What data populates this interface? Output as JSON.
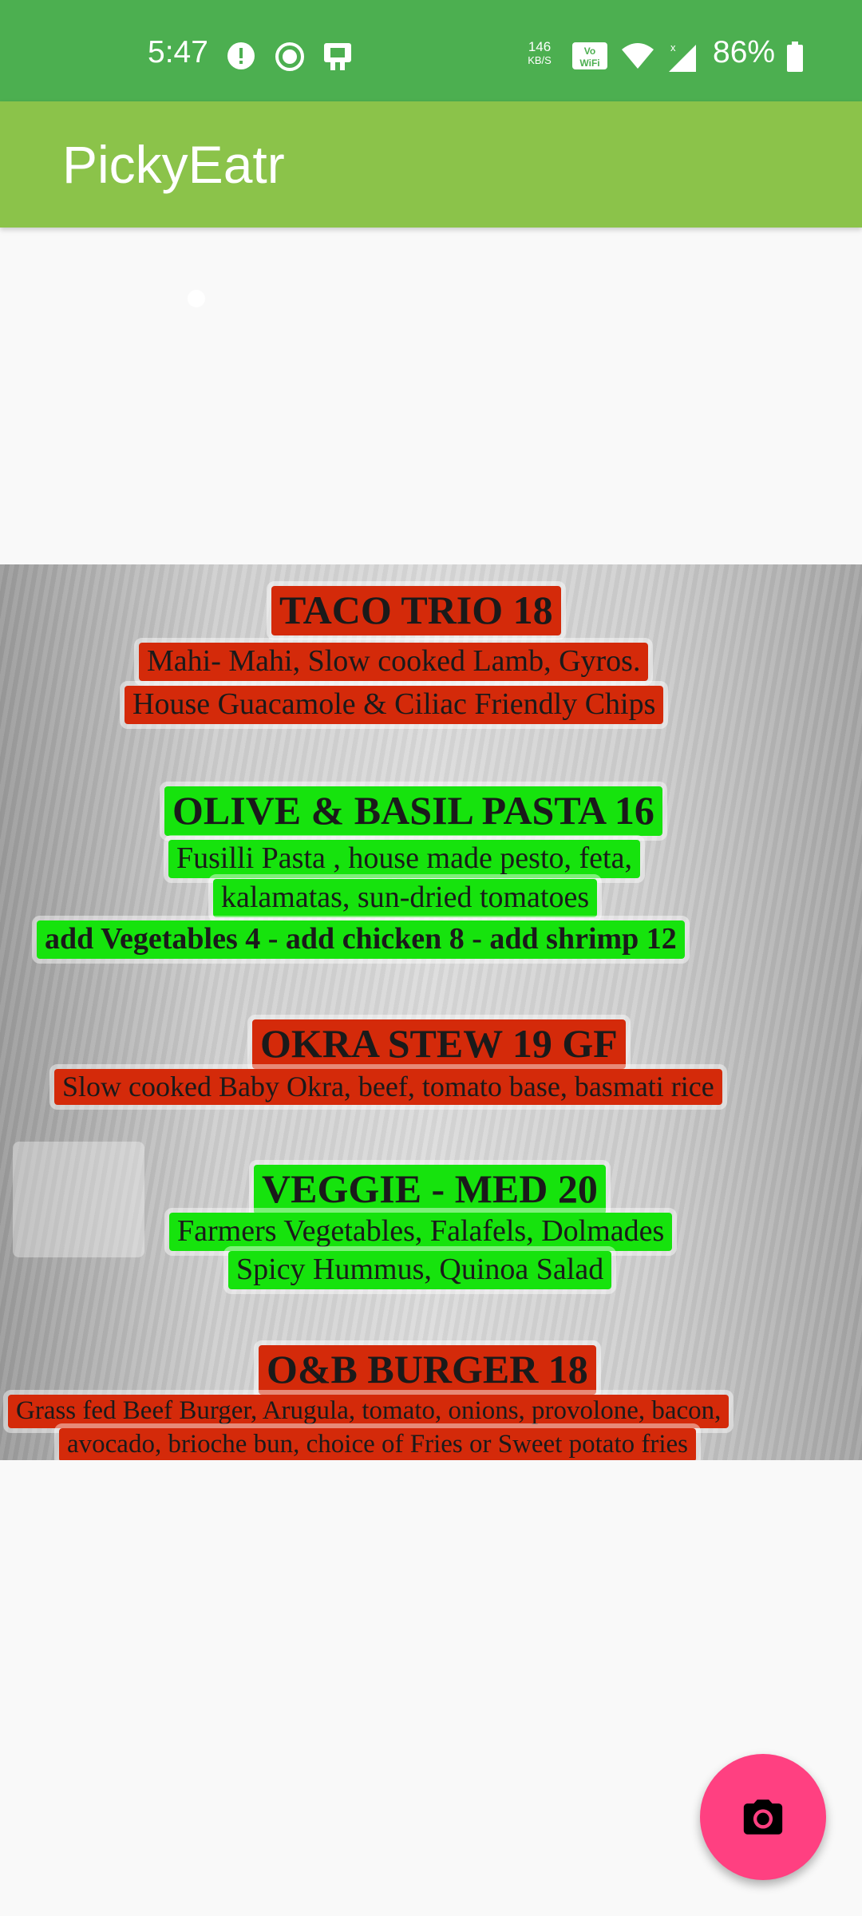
{
  "status_bar": {
    "time": "5:47",
    "net_speed": "146",
    "net_unit": "KB/S",
    "battery_pct": "86%",
    "icons": [
      "alert-icon",
      "record-icon",
      "device-icon",
      "volte-wifi-icon",
      "wifi-icon",
      "signal-icon",
      "battery-icon"
    ]
  },
  "app_bar": {
    "title": "PickyEatr",
    "color": "#8bc34a"
  },
  "menu": {
    "lines": [
      {
        "text": "TACO TRIO  18",
        "status": "red",
        "kind": "heading"
      },
      {
        "text": "Mahi- Mahi, Slow cooked Lamb,  Gyros.",
        "status": "red",
        "kind": "desc"
      },
      {
        "text": "House Guacamole & Ciliac Friendly Chips",
        "status": "red",
        "kind": "desc"
      },
      {
        "text": "OLIVE & BASIL PASTA   16",
        "status": "green",
        "kind": "heading"
      },
      {
        "text": "Fusilli Pasta , house made pesto, feta,",
        "status": "green",
        "kind": "desc"
      },
      {
        "text": "kalamatas, sun-dried tomatoes",
        "status": "green",
        "kind": "desc"
      },
      {
        "text": "add Vegetables 4  -  add chicken 8 -  add shrimp 12",
        "status": "green",
        "kind": "desc"
      },
      {
        "text": "OKRA STEW  19  GF",
        "status": "red",
        "kind": "heading"
      },
      {
        "text": "Slow cooked Baby Okra, beef, tomato base, basmati rice",
        "status": "red",
        "kind": "desc"
      },
      {
        "text": "VEGGIE - MED   20",
        "status": "green",
        "kind": "heading"
      },
      {
        "text": "Farmers Vegetables, Falafels, Dolmades",
        "status": "green",
        "kind": "desc"
      },
      {
        "text": "Spicy Hummus, Quinoa Salad",
        "status": "green",
        "kind": "desc"
      },
      {
        "text": "O&B BURGER  18",
        "status": "red",
        "kind": "heading"
      },
      {
        "text": "Grass fed Beef Burger, Arugula, tomato, onions, provolone, bacon,",
        "status": "red",
        "kind": "desc"
      },
      {
        "text": "avocado, brioche bun, choice of Fries or Sweet potato fries",
        "status": "red",
        "kind": "desc"
      }
    ],
    "colors": {
      "red": "#d42a0a",
      "green": "#16e30d"
    }
  },
  "fab": {
    "icon": "camera-icon",
    "color": "#ff4081"
  }
}
